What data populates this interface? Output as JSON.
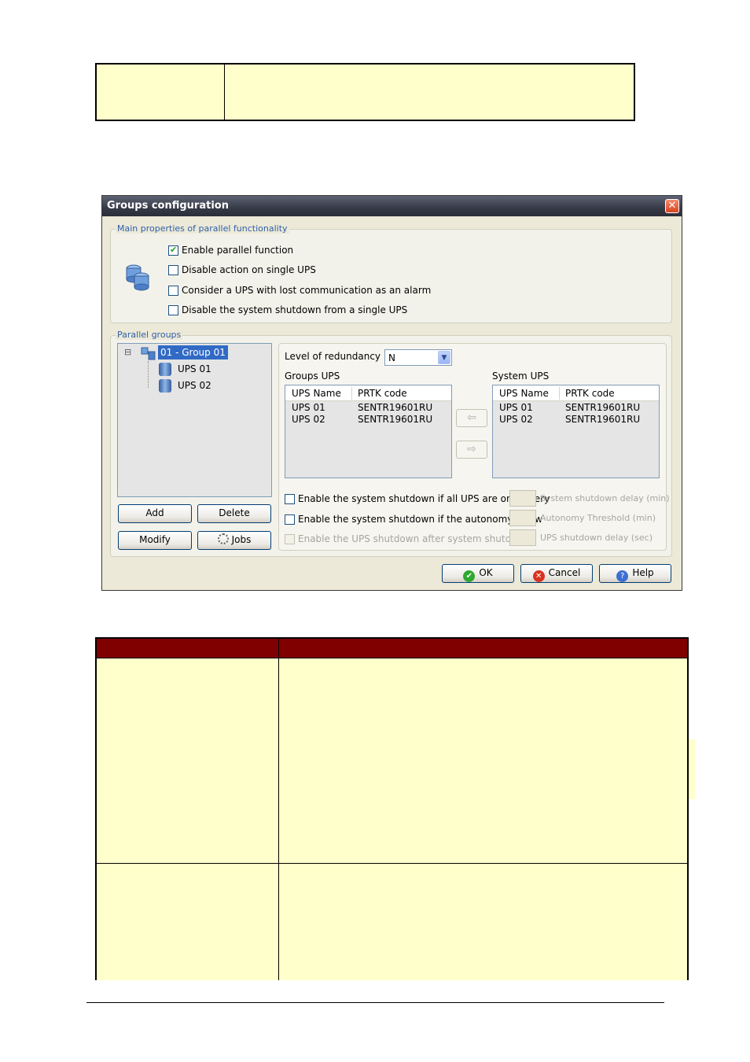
{
  "dialog": {
    "title": "Groups configuration",
    "close_glyph": "✕",
    "main_group_label": "Main properties of parallel functionality",
    "options": [
      {
        "label": "Enable parallel function",
        "checked": true
      },
      {
        "label": "Disable action on single UPS",
        "checked": false
      },
      {
        "label": "Consider a UPS with lost communication as an alarm",
        "checked": false
      },
      {
        "label": "Disable the system shutdown from a single UPS",
        "checked": false
      }
    ],
    "parallel_group_label": "Parallel groups",
    "tree": {
      "expander": "⊟",
      "group": "01 - Group 01",
      "children": [
        "UPS 01",
        "UPS 02"
      ]
    },
    "buttons": {
      "add": "Add",
      "delete": "Delete",
      "modify": "Modify",
      "jobs": "Jobs",
      "ok": "OK",
      "cancel": "Cancel",
      "help": "Help"
    },
    "redundancy": {
      "label": "Level of redundancy",
      "value": "N"
    },
    "groups_ups": {
      "label": "Groups UPS",
      "columns": [
        "UPS Name",
        "PRTK code"
      ],
      "rows": [
        [
          "UPS 01",
          "SENTR19601RU"
        ],
        [
          "UPS 02",
          "SENTR19601RU"
        ]
      ]
    },
    "system_ups": {
      "label": "System UPS",
      "columns": [
        "UPS Name",
        "PRTK code"
      ],
      "rows": [
        [
          "UPS 01",
          "SENTR19601RU"
        ],
        [
          "UPS 02",
          "SENTR19601RU"
        ]
      ]
    },
    "arrows": {
      "left": "⇦",
      "right": "⇨"
    },
    "shutdown_options": [
      {
        "label": "Enable the system shutdown if all UPS are on battery",
        "checked": false,
        "enabled": true,
        "field_label": "System shutdown delay (min)"
      },
      {
        "label": "Enable the system shutdown if the autonomy is low",
        "checked": false,
        "enabled": true,
        "field_label": "Autonomy Threshold (min)"
      },
      {
        "label": "Enable the UPS shutdown after system shutdown",
        "checked": false,
        "enabled": false,
        "field_label": "UPS shutdown delay (sec)"
      }
    ]
  },
  "colors": {
    "table_fill": "#ffffcc",
    "header_fill": "#800000",
    "dialog_bg": "#ece9d8",
    "group_label": "#2f5fa8"
  }
}
